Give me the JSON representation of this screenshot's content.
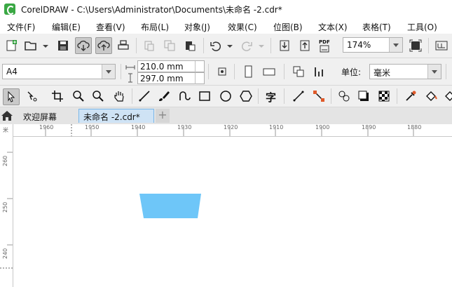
{
  "window": {
    "title": "CorelDRAW - C:\\Users\\Administrator\\Documents\\未命名 -2.cdr*"
  },
  "menu": [
    "文件(F)",
    "编辑(E)",
    "查看(V)",
    "布局(L)",
    "对象(J)",
    "效果(C)",
    "位图(B)",
    "文本(X)",
    "表格(T)",
    "工具(O)"
  ],
  "standard_toolbar": {
    "zoom_level": "174%",
    "pdf_label": "PDF"
  },
  "property_bar": {
    "page_size": "A4",
    "width": "210.0 mm",
    "height": "297.0 mm",
    "units_label": "单位:",
    "units_value": "毫米"
  },
  "toolbox": {
    "text_tool_glyph": "字"
  },
  "tabs": {
    "welcome": "欢迎屏幕",
    "document": "未命名 -2.cdr*",
    "add": "+"
  },
  "ruler": {
    "horizontal": [
      "1960",
      "1950",
      "1940",
      "1930",
      "1920",
      "1910",
      "1900",
      "1890",
      "1880"
    ],
    "vertical": [
      "260",
      "250",
      "240"
    ],
    "unit_hint": "米"
  },
  "colors": {
    "shape_fill": "#6ec6f8",
    "accent": "#79b7ea",
    "logo": "#3aa844"
  }
}
